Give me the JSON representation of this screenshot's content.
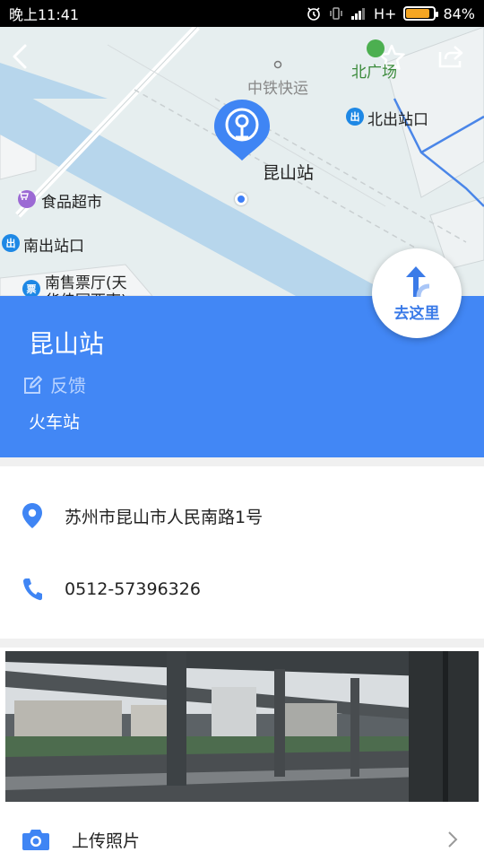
{
  "status_bar": {
    "time": "晚上11:41",
    "network": "H+",
    "battery": "84%",
    "battery_level": 0.84
  },
  "map": {
    "labels": {
      "zhongtie": "中铁快运",
      "beiguangchang": "北广场",
      "north_exit": "北出站口",
      "station": "昆山站",
      "supermarket": "食品超市",
      "south_exit": "南出站口",
      "south_ticket_1": "南售票厅(天",
      "south_ticket_2": "华佳园西南)"
    },
    "poi_badges": {
      "exit": "出",
      "ticket": "票"
    },
    "icons": {
      "back": "back-arrow-icon",
      "favorite": "star-icon",
      "share": "share-icon"
    }
  },
  "info": {
    "name": "昆山站",
    "feedback": "反馈",
    "category": "火车站",
    "go_label": "去这里",
    "accent_color": "#4287f5"
  },
  "details": {
    "address": "苏州市昆山市人民南路1号",
    "phone": "0512-57396326"
  },
  "upload": {
    "label": "上传照片"
  }
}
